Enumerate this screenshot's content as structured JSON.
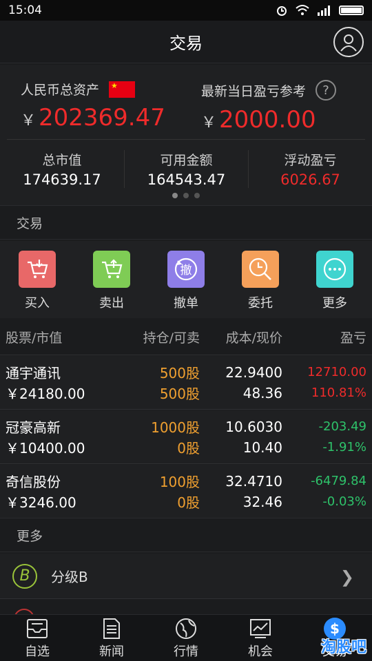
{
  "status_bar": {
    "time": "15:04"
  },
  "header": {
    "title": "交易"
  },
  "assets": {
    "rmb_total_label": "人民币总资产",
    "rmb_total_currency": "￥",
    "rmb_total_value": "202369.47",
    "daily_pl_label": "最新当日盈亏参考",
    "daily_pl_currency": "￥",
    "daily_pl_value": "2000.00",
    "help_symbol": "?",
    "stats": [
      {
        "label": "总市值",
        "value": "174639.17"
      },
      {
        "label": "可用金额",
        "value": "164543.47"
      },
      {
        "label": "浮动盈亏",
        "value": "6026.67"
      }
    ]
  },
  "trade_section": {
    "title": "交易"
  },
  "actions": [
    {
      "label": "买入",
      "icon": "cart-in-icon",
      "color": "#e86868"
    },
    {
      "label": "卖出",
      "icon": "cart-out-icon",
      "color": "#7fcc55"
    },
    {
      "label": "撤单",
      "icon": "undo-icon",
      "color": "#8e7ee8",
      "glyph": "撤"
    },
    {
      "label": "委托",
      "icon": "search-clock-icon",
      "color": "#f5a05a"
    },
    {
      "label": "更多",
      "icon": "more-icon",
      "color": "#3fd4cf"
    }
  ],
  "holdings_table": {
    "headers": [
      "股票/市值",
      "持仓/可卖",
      "成本/现价",
      "盈亏"
    ],
    "rows": [
      {
        "name": "通宇通讯",
        "market_value": "￥24180.00",
        "position": "500股",
        "sellable": "500股",
        "cost": "22.9400",
        "price": "48.36",
        "pl": "12710.00",
        "pl_pct": "110.81%",
        "trend": "up"
      },
      {
        "name": "冠豪高新",
        "market_value": "￥10400.00",
        "position": "1000股",
        "sellable": "0股",
        "cost": "10.6030",
        "price": "10.40",
        "pl": "-203.49",
        "pl_pct": "-1.91%",
        "trend": "down"
      },
      {
        "name": "奇信股份",
        "market_value": "￥3246.00",
        "position": "100股",
        "sellable": "0股",
        "cost": "32.4710",
        "price": "32.46",
        "pl": "-6479.84",
        "pl_pct": "-0.03%",
        "trend": "down"
      }
    ]
  },
  "more_section": {
    "title": "更多",
    "items": [
      {
        "label": "分级B",
        "icon_letter": "B"
      }
    ]
  },
  "tabbar": {
    "tabs": [
      {
        "label": "自选",
        "icon": "inbox-icon"
      },
      {
        "label": "新闻",
        "icon": "news-icon"
      },
      {
        "label": "行情",
        "icon": "globe-icon"
      },
      {
        "label": "机会",
        "icon": "chart-icon"
      },
      {
        "label": "交易",
        "icon": "dollar-icon",
        "active": true
      }
    ]
  },
  "watermark": "淘股吧"
}
